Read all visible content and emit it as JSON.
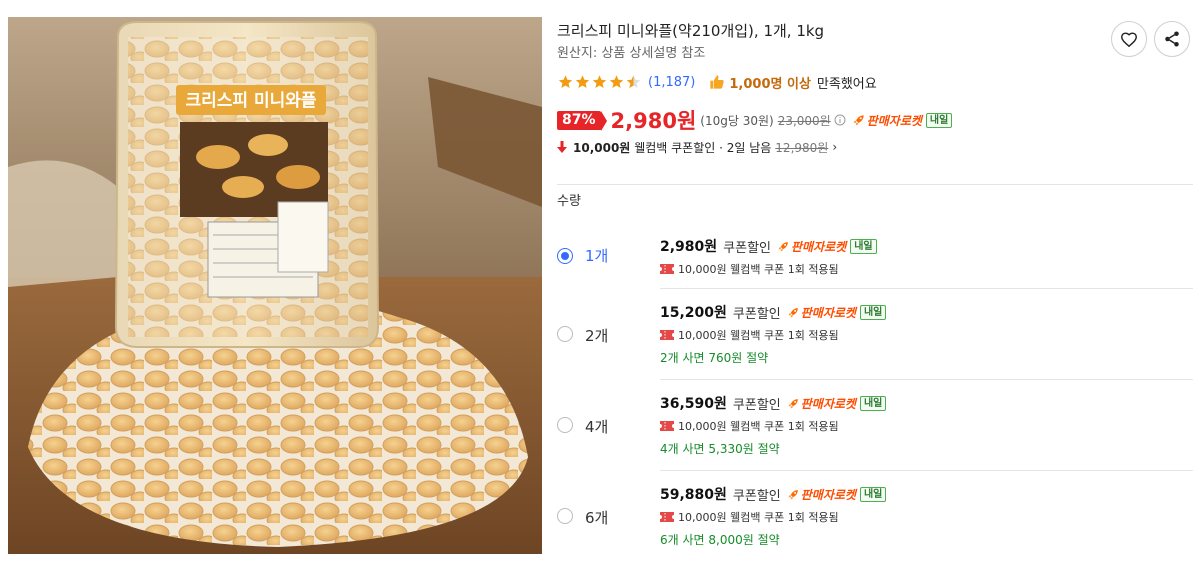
{
  "product": {
    "title": "크리스피 미니와플(약210개입), 1개, 1kg",
    "origin": "원산지: 상품 상세설명 참조",
    "image_label": "크리스피 미니와플"
  },
  "rating": {
    "stars": 4.5,
    "review_count": "(1,187)",
    "satisfied_count": "1,000명 이상",
    "satisfied_text": "만족했어요"
  },
  "price": {
    "discount": "87%",
    "sale": "2,980원",
    "unit": "(10g당 30원)",
    "original": "23,000원",
    "seller_rocket": "판매자로켓",
    "tomorrow": "내일"
  },
  "coupon": {
    "amount": "10,000원",
    "text": "웰컴백 쿠폰할인 · 2일 남음",
    "original": "12,980원",
    "chevron": "›"
  },
  "quantity": {
    "label": "수량",
    "options": [
      {
        "qty": "1개",
        "price": "2,980원",
        "coupon": "쿠폰할인",
        "rocket": "판매자로켓",
        "tomorrow": "내일",
        "welcome": "10,000원 웰컴백 쿠폰 1회 적용됨",
        "saving": "",
        "selected": true
      },
      {
        "qty": "2개",
        "price": "15,200원",
        "coupon": "쿠폰할인",
        "rocket": "판매자로켓",
        "tomorrow": "내일",
        "welcome": "10,000원 웰컴백 쿠폰 1회 적용됨",
        "saving": "2개 사면 760원 절약",
        "selected": false
      },
      {
        "qty": "4개",
        "price": "36,590원",
        "coupon": "쿠폰할인",
        "rocket": "판매자로켓",
        "tomorrow": "내일",
        "welcome": "10,000원 웰컴백 쿠폰 1회 적용됨",
        "saving": "4개 사면 5,330원 절약",
        "selected": false
      },
      {
        "qty": "6개",
        "price": "59,880원",
        "coupon": "쿠폰할인",
        "rocket": "판매자로켓",
        "tomorrow": "내일",
        "welcome": "10,000원 웰컴백 쿠폰 1회 적용됨",
        "saving": "6개 사면 8,000원 절약",
        "selected": false
      }
    ]
  },
  "icons": {
    "favorite": "heart-icon",
    "share": "share-icon",
    "thumbs_up": "thumbs-up-icon",
    "rocket": "rocket-icon",
    "coupon": "ticket-icon",
    "down_arrow": "down-arrow-icon",
    "info": "info-icon"
  },
  "colors": {
    "accent_red": "#e52528",
    "link_blue": "#346aff",
    "star_orange": "#f39c12",
    "saving_green": "#168c2a",
    "rocket_orange": "#ff4d00"
  }
}
